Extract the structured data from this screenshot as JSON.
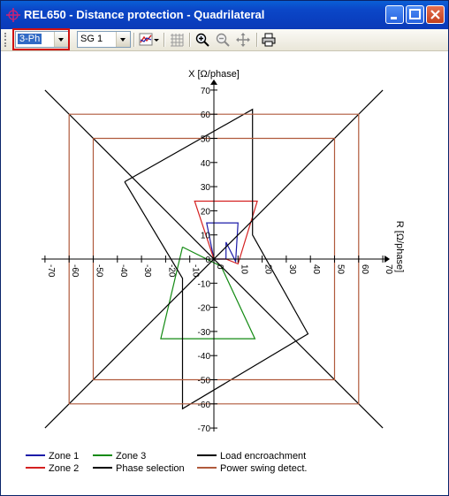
{
  "window": {
    "title": "REL650 - Distance protection - Quadrilateral",
    "icons": [
      "app-icon",
      "minimize-icon",
      "maximize-icon",
      "close-icon"
    ]
  },
  "toolbar": {
    "phase_value": "3-Ph",
    "setting_group_value": "SG 1",
    "icons": [
      "chart-style-icon",
      "grid-icon",
      "zoom-in-icon",
      "zoom-out-icon",
      "pan-icon",
      "print-icon"
    ]
  },
  "chart_data": {
    "type": "line",
    "xlabel": "R [Ω/phase]",
    "ylabel": "X [Ω/phase]",
    "xlim": [
      -70,
      70
    ],
    "ylim": [
      -70,
      70
    ],
    "x_ticks": [
      "-70",
      "-60",
      "-50",
      "-40",
      "-30",
      "-20",
      "-10",
      "0",
      "10",
      "20",
      "30",
      "40",
      "50",
      "60",
      "70"
    ],
    "y_ticks": [
      "70",
      "60",
      "50",
      "40",
      "30",
      "20",
      "10",
      "0",
      "-10",
      "-20",
      "-30",
      "-40",
      "-50",
      "-60",
      "-70"
    ],
    "grid": false,
    "legend_position": "bottom",
    "series": [
      {
        "name": "Zone 1",
        "color": "#1c1ca8",
        "points": [
          [
            0,
            0
          ],
          [
            -3,
            15
          ],
          [
            10,
            15
          ],
          [
            9,
            -1
          ],
          [
            5,
            7
          ],
          [
            5,
            0
          ],
          [
            0,
            0
          ]
        ]
      },
      {
        "name": "Zone 2",
        "color": "#d42020",
        "points": [
          [
            0,
            0
          ],
          [
            -8,
            24
          ],
          [
            18,
            24
          ],
          [
            10,
            -2
          ],
          [
            5,
            0
          ],
          [
            0,
            0
          ]
        ]
      },
      {
        "name": "Zone 3",
        "color": "#128a12",
        "points": [
          [
            -13,
            5
          ],
          [
            -22,
            -33
          ],
          [
            17,
            -33
          ],
          [
            3,
            -3
          ],
          [
            -13,
            5
          ]
        ]
      },
      {
        "name": "Phase selection",
        "color": "#000000",
        "points": [
          [
            -37,
            32
          ],
          [
            16,
            62
          ],
          [
            16,
            10
          ],
          [
            39,
            -31
          ],
          [
            -13,
            -62
          ],
          [
            -13,
            -8
          ],
          [
            -37,
            32
          ]
        ]
      },
      {
        "name": "Load encroachment",
        "color": "#000000",
        "points": [
          [
            -70,
            70
          ],
          [
            70,
            -70
          ]
        ]
      },
      {
        "name": "Load encroachment",
        "color": "#000000",
        "points": [
          [
            -70,
            -70
          ],
          [
            70,
            70
          ]
        ]
      },
      {
        "name": "Power swing detect.",
        "color": "#b05a3c",
        "points": [
          [
            -60,
            60
          ],
          [
            60,
            60
          ],
          [
            60,
            -60
          ],
          [
            -60,
            -60
          ],
          [
            -60,
            60
          ]
        ]
      },
      {
        "name": "Power swing detect.",
        "color": "#b05a3c",
        "points": [
          [
            -50,
            50
          ],
          [
            50,
            50
          ],
          [
            50,
            -50
          ],
          [
            -50,
            -50
          ],
          [
            -50,
            50
          ]
        ]
      }
    ],
    "legend": [
      {
        "label": "Zone 1",
        "color": "#1c1ca8"
      },
      {
        "label": "Zone 3",
        "color": "#128a12"
      },
      {
        "label": "Load encroachment",
        "color": "#000000"
      },
      {
        "label": "Zone 2",
        "color": "#d42020"
      },
      {
        "label": "Phase selection",
        "color": "#000000"
      },
      {
        "label": "Power swing detect.",
        "color": "#b05a3c"
      }
    ]
  }
}
